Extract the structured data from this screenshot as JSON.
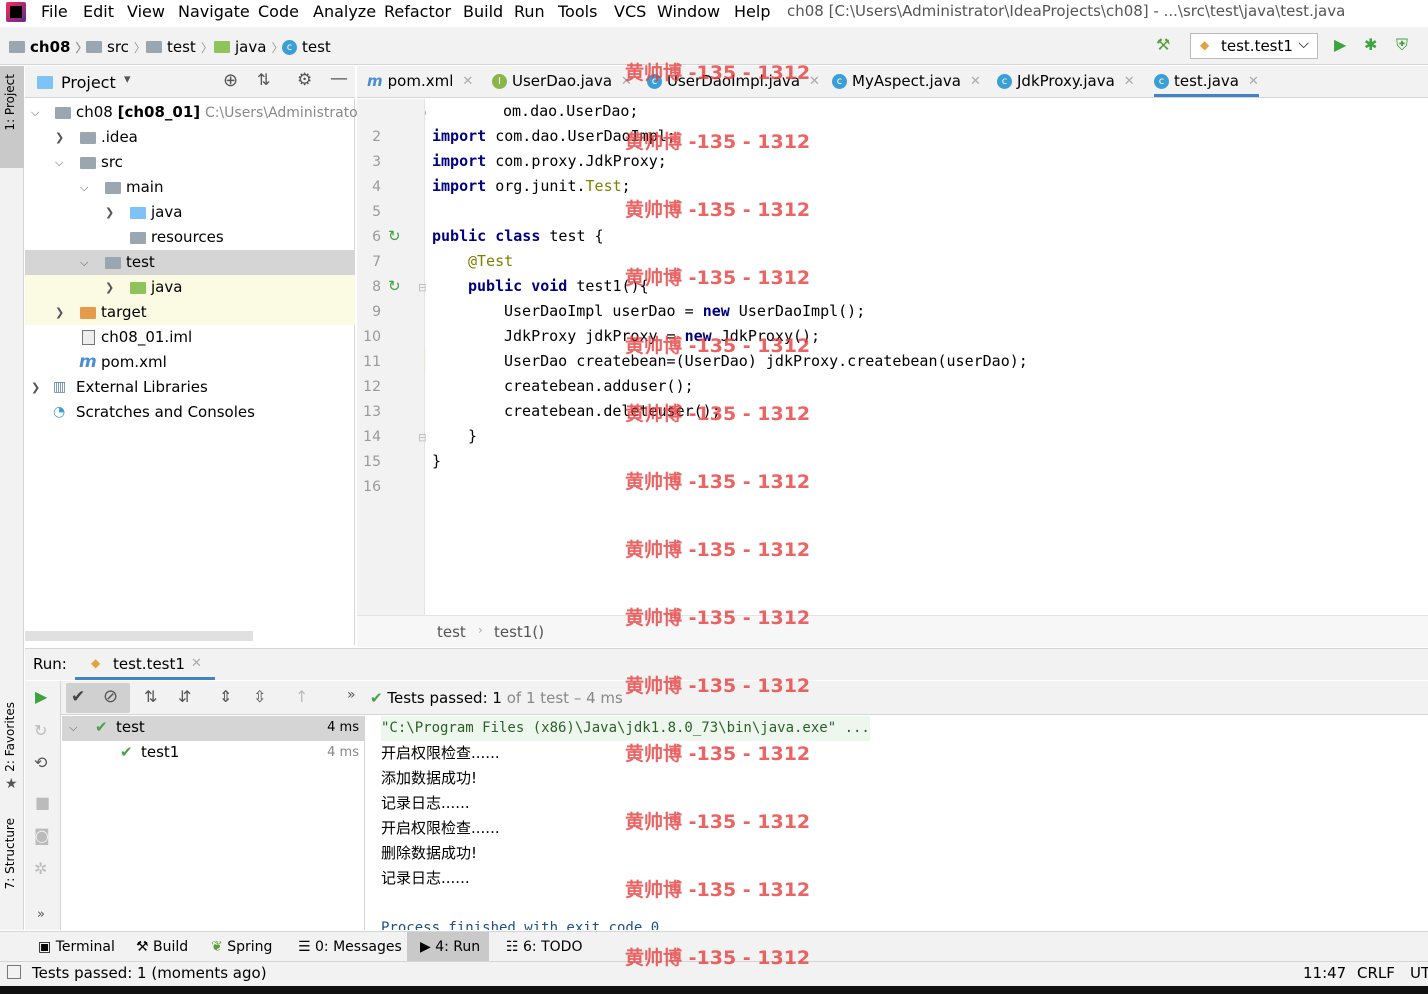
{
  "menubar": {
    "items": [
      "File",
      "Edit",
      "View",
      "Navigate",
      "Code",
      "Analyze",
      "Refactor",
      "Build",
      "Run",
      "Tools",
      "VCS",
      "Window",
      "Help"
    ],
    "title": "ch08 [C:\\Users\\Administrator\\IdeaProjects\\ch08] - ...\\src\\test\\java\\test.java"
  },
  "navbar": {
    "crumbs": [
      "ch08",
      "src",
      "test",
      "java",
      "test"
    ],
    "run_config": "test.test1"
  },
  "project": {
    "header": "Project",
    "tree": [
      {
        "label": "ch08",
        "bold": "[ch08_01]",
        "path": "C:\\Users\\Administrator\\IdeaProjects\\ch08"
      },
      {
        "label": ".idea"
      },
      {
        "label": "src"
      },
      {
        "label": "main"
      },
      {
        "label": "java"
      },
      {
        "label": "resources"
      },
      {
        "label": "test"
      },
      {
        "label": "java"
      },
      {
        "label": "target"
      },
      {
        "label": "ch08_01.iml"
      },
      {
        "label": "pom.xml"
      },
      {
        "label": "External Libraries"
      },
      {
        "label": "Scratches and Consoles"
      }
    ]
  },
  "editor": {
    "tabs": [
      "pom.xml",
      "UserDao.java",
      "UserDaoImpl.java",
      "MyAspect.java",
      "JdkProxy.java",
      "test.java"
    ],
    "line_numbers": [
      "2",
      "3",
      "4",
      "5",
      "6",
      "7",
      "8",
      "9",
      "10",
      "11",
      "12",
      "13",
      "14",
      "15",
      "16"
    ],
    "line1_tail": "om.dao.UserDao;",
    "lines": {
      "l2": [
        "import",
        " com.dao.UserDaoImpl;"
      ],
      "l3": [
        "import",
        " com.proxy.JdkProxy;"
      ],
      "l4": [
        "import",
        " org.junit.",
        "Test",
        ";"
      ],
      "l6": [
        "public class",
        " test {"
      ],
      "l7": "@Test",
      "l8": [
        "public void",
        " test1(){"
      ],
      "l9": [
        "UserDaoImpl userDao = ",
        "new",
        " UserDaoImpl();"
      ],
      "l10": [
        "JdkProxy jdkProxy = ",
        "new",
        " JdkProxy();"
      ],
      "l11": "UserDao createbean=(UserDao) jdkProxy.createbean(userDao);",
      "l12": "createbean.adduser();",
      "l13": "createbean.deleteuser();",
      "l14": "}",
      "l15": "}"
    },
    "breadcrumb": [
      "test",
      "test1()"
    ]
  },
  "run": {
    "label": "Run:",
    "tab": "test.test1",
    "status": {
      "prefix": "Tests passed: ",
      "count": "1",
      "suffix": " of 1 test – 4 ms"
    },
    "tree": [
      {
        "name": "test",
        "time": "4 ms"
      },
      {
        "name": "test1",
        "time": "4 ms"
      }
    ],
    "console": [
      "\"C:\\Program Files (x86)\\Java\\jdk1.8.0_73\\bin\\java.exe\" ...",
      "开启权限检查......",
      "添加数据成功!",
      "记录日志......",
      "开启权限检查......",
      "删除数据成功!",
      "记录日志......",
      "",
      "Process finished with exit code 0"
    ]
  },
  "bottom_tabs": [
    "Terminal",
    "Build",
    "Spring",
    "0: Messages",
    "4: Run",
    "6: TODO"
  ],
  "left_tabs": [
    "1: Project",
    "2: Favorites",
    "7: Structure"
  ],
  "statusbar": {
    "message": "Tests passed: 1 (moments ago)",
    "position": "11:47",
    "line_sep": "CRLF",
    "encoding": "UT"
  },
  "watermark": "黄帅博 -135 - 1312",
  "colors": {
    "keyword": "#000080",
    "annotation": "#808000",
    "accent": "#4083c9",
    "pass": "#4aa04a",
    "watermark": "#e63c3c"
  }
}
